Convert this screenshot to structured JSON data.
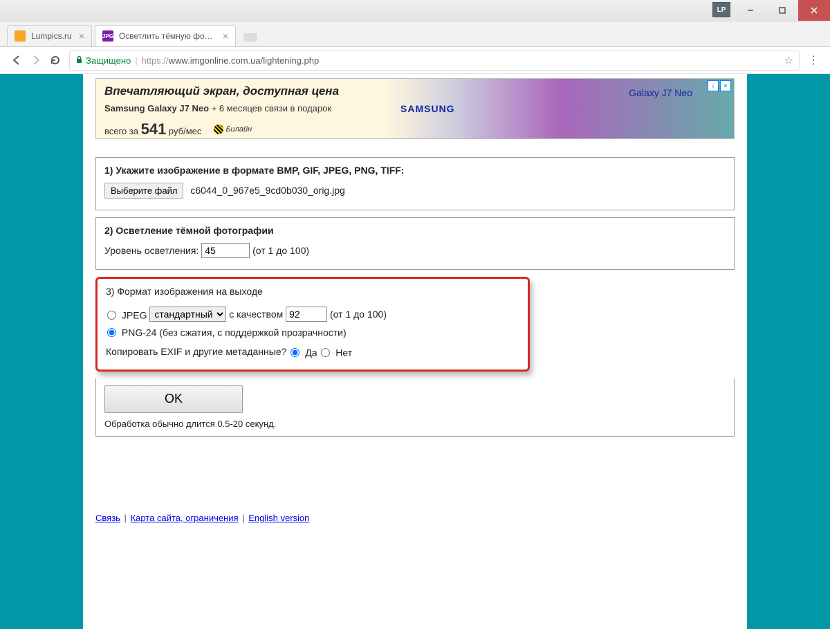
{
  "window": {
    "lp_badge": "LP"
  },
  "tabs": [
    {
      "label": "Lumpics.ru",
      "favicon_bg": "#f5a623",
      "favicon_text": ""
    },
    {
      "label": "Осветлить тёмную фото…",
      "favicon_bg": "#7b1fa2",
      "favicon_text": "JPG"
    }
  ],
  "address": {
    "secure_label": "Защищено",
    "proto": "https://",
    "url_rest": "www.imgonline.com.ua/lightening.php"
  },
  "ad": {
    "headline": "Впечатляющий экран, доступная цена",
    "line_prefix": "Samsung Galaxy J7 Neo",
    "line_mid": " + 6 месяцев связи в подарок",
    "line2_prefix": "всего за ",
    "price": "541",
    "line2_suffix": " руб/мес",
    "brand": "SAMSUNG",
    "product": "Galaxy J7 Neo",
    "beeline": "Билайн",
    "adchoices_i": "i",
    "adchoices_x": "✕"
  },
  "step1": {
    "heading": "1) Укажите изображение в формате BMP, GIF, JPEG, PNG, TIFF:",
    "button": "Выберите файл",
    "filename": "c6044_0_967e5_9cd0b030_orig.jpg"
  },
  "step2": {
    "heading": "2) Осветление тёмной фотографии",
    "label": "Уровень осветления:",
    "value": "45",
    "hint": "(от 1 до 100)"
  },
  "step3": {
    "heading": "3) Формат изображения на выходе",
    "jpeg_label": "JPEG",
    "jpeg_mode": "стандартный",
    "quality_prefix": "с качеством",
    "quality_value": "92",
    "quality_hint": "(от 1 до 100)",
    "png_label": "PNG-24 (без сжатия, с поддержкой прозрачности)",
    "exif_question": "Копировать EXIF и другие метаданные?",
    "yes": "Да",
    "no": "Нет"
  },
  "submit": {
    "ok": "OK",
    "note": "Обработка обычно длится 0.5-20 секунд."
  },
  "footer": {
    "link1": "Связь",
    "link2": "Карта сайта, ограничения",
    "link3": "English version",
    "sep": "|"
  }
}
